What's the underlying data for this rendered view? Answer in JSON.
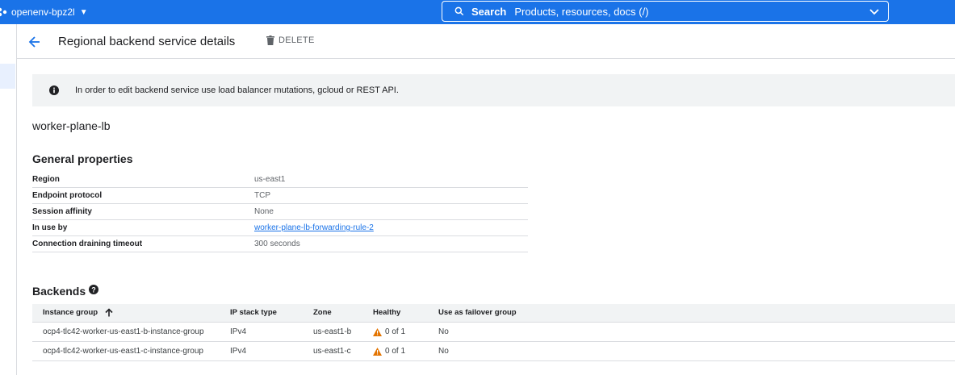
{
  "topbar": {
    "project_name": "openenv-bpz2l",
    "search_label": "Search",
    "search_placeholder": "Products, resources, docs (/)"
  },
  "header": {
    "title": "Regional backend service details",
    "delete_label": "DELETE"
  },
  "banner": {
    "text": "In order to edit backend service use load balancer mutations, gcloud or REST API."
  },
  "service_name": "worker-plane-lb",
  "general": {
    "title": "General properties",
    "rows": [
      {
        "key": "Region",
        "value": "us-east1"
      },
      {
        "key": "Endpoint protocol",
        "value": "TCP"
      },
      {
        "key": "Session affinity",
        "value": "None"
      },
      {
        "key": "In use by",
        "value": "worker-plane-lb-forwarding-rule-2"
      },
      {
        "key": "Connection draining timeout",
        "value": "300 seconds"
      }
    ]
  },
  "backends": {
    "title": "Backends",
    "columns": [
      "Instance group",
      "IP stack type",
      "Zone",
      "Healthy",
      "Use as failover group"
    ],
    "rows": [
      {
        "group": "ocp4-tlc42-worker-us-east1-b-instance-group",
        "ip": "IPv4",
        "zone": "us-east1-b",
        "healthy": "0 of 1",
        "failover": "No"
      },
      {
        "group": "ocp4-tlc42-worker-us-east1-c-instance-group",
        "ip": "IPv4",
        "zone": "us-east1-c",
        "healthy": "0 of 1",
        "failover": "No"
      }
    ]
  },
  "colors": {
    "accent": "#1a73e8",
    "warning": "#e37400",
    "banner_bg": "#f1f3f4"
  },
  "icons": {
    "project": "project-dots-icon",
    "search": "search-icon",
    "expand": "chevron-down-icon",
    "back": "arrow-back-icon",
    "delete": "trash-icon",
    "info": "info-icon",
    "help": "help-icon",
    "sort": "arrow-up-icon",
    "warning": "warning-icon"
  }
}
